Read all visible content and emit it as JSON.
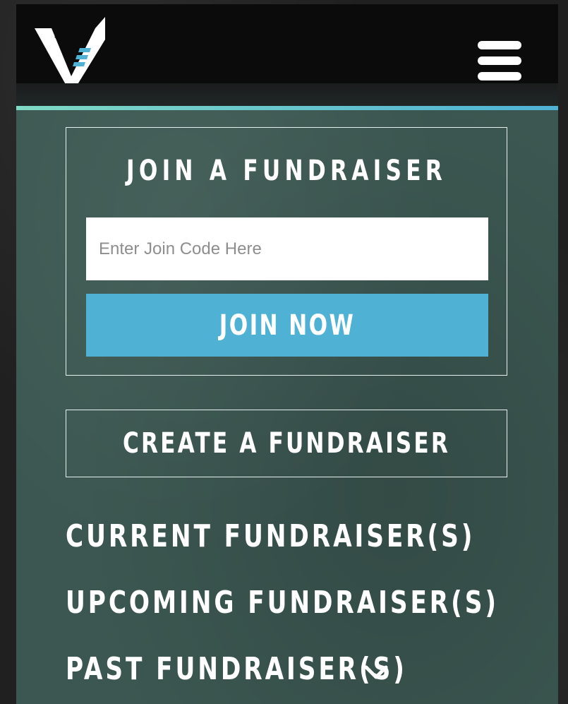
{
  "header": {
    "logo_icon": "v-logo-icon",
    "menu_icon": "hamburger-menu-icon"
  },
  "join": {
    "title": "Join a Fundraiser",
    "input_placeholder": "Enter Join Code Here",
    "input_value": "",
    "button_label": "Join Now"
  },
  "create": {
    "button_label": "Create a Fundraiser"
  },
  "nav": {
    "current": "Current Fundraiser(s)",
    "upcoming": "Upcoming Fundraiser(s)",
    "past": "Past Fundraiser(s)",
    "past_icon": "chevron-down-icon"
  },
  "colors": {
    "header_bg": "#0b0b0b",
    "page_bg": "#3c5751",
    "accent": "#4fb2d5",
    "accent_bar_start": "#7fd9c4",
    "accent_bar_end": "#4fb2d5",
    "text": "#ffffff"
  }
}
